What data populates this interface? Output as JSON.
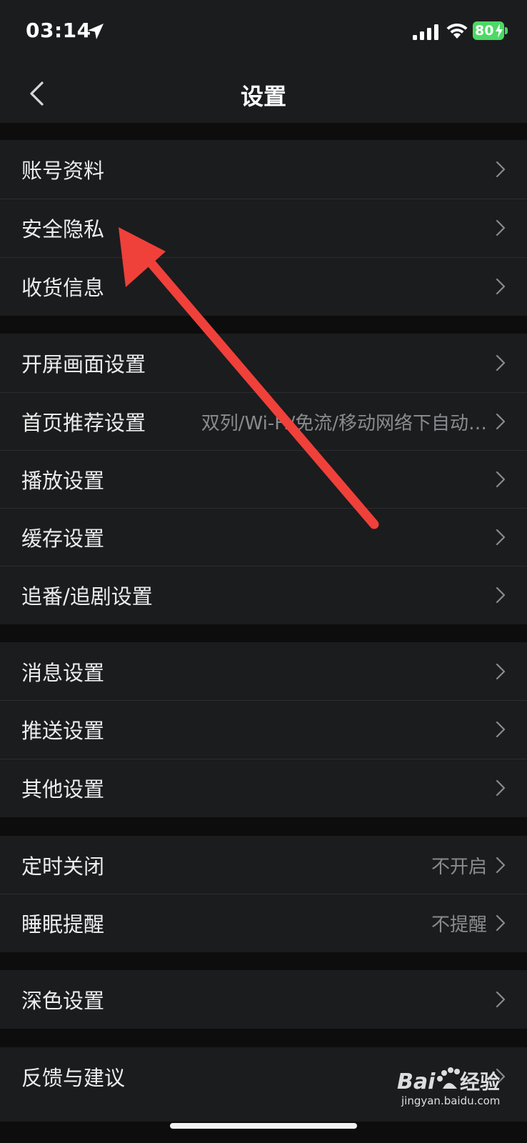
{
  "status_bar": {
    "time": "03:14",
    "battery": "80"
  },
  "nav": {
    "title": "设置"
  },
  "rows": [
    {
      "label": "账号资料",
      "value": ""
    },
    {
      "label": "安全隐私",
      "value": ""
    },
    {
      "label": "收货信息",
      "value": ""
    },
    {
      "label": "开屏画面设置",
      "value": ""
    },
    {
      "label": "首页推荐设置",
      "value": "双列/Wi-Fi/免流/移动网络下自动…"
    },
    {
      "label": "播放设置",
      "value": ""
    },
    {
      "label": "缓存设置",
      "value": ""
    },
    {
      "label": "追番/追剧设置",
      "value": ""
    },
    {
      "label": "消息设置",
      "value": ""
    },
    {
      "label": "推送设置",
      "value": ""
    },
    {
      "label": "其他设置",
      "value": ""
    },
    {
      "label": "定时关闭",
      "value": "不开启"
    },
    {
      "label": "睡眠提醒",
      "value": "不提醒"
    },
    {
      "label": "深色设置",
      "value": ""
    },
    {
      "label": "反馈与建议",
      "value": ""
    }
  ],
  "watermark": {
    "logo": "Bai du 经验",
    "url": "jingyan.baidu.com"
  },
  "colors": {
    "background": "#0d0d0e",
    "row_background": "#1b1c1e",
    "annotation_arrow": "#f0403a",
    "battery": "#4cd964"
  }
}
